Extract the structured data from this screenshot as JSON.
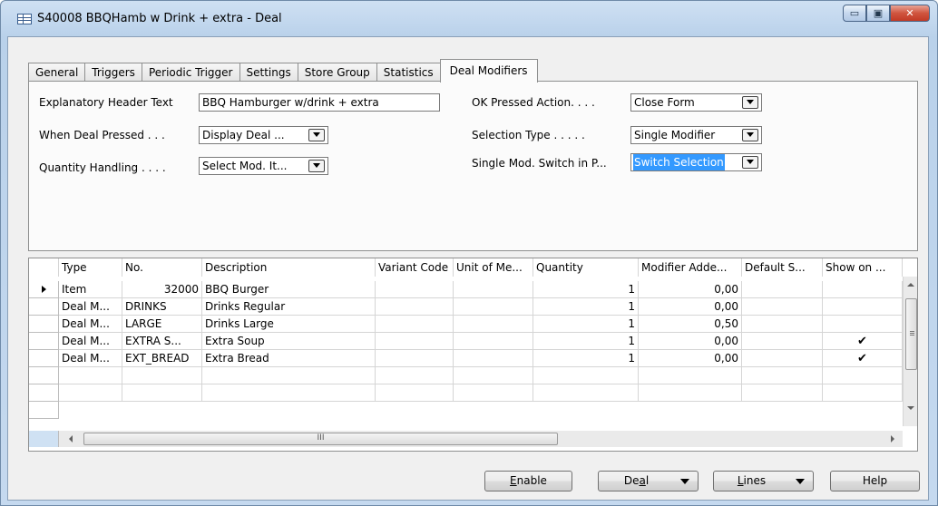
{
  "window": {
    "title": "S40008 BBQHamb w Drink + extra - Deal",
    "controls": {
      "minimize": "▭",
      "maximize": "▣",
      "close": "✕"
    }
  },
  "tabs": [
    "General",
    "Triggers",
    "Periodic Trigger",
    "Settings",
    "Store Group",
    "Statistics",
    "Deal Modifiers"
  ],
  "active_tab": "Deal Modifiers",
  "form": {
    "explanatory_header_label": "Explanatory Header Text",
    "explanatory_header_value": "BBQ Hamburger w/drink + extra",
    "when_deal_pressed_label": "When Deal Pressed . . .",
    "when_deal_pressed_value": "Display Deal ...",
    "quantity_handling_label": "Quantity Handling . . . .",
    "quantity_handling_value": "Select Mod. It...",
    "ok_pressed_action_label": "OK Pressed Action. . . .",
    "ok_pressed_action_value": "Close Form",
    "selection_type_label": "Selection Type . . . . .",
    "selection_type_value": "Single Modifier",
    "single_mod_switch_label": "Single Mod. Switch in P...",
    "single_mod_switch_value": "Switch Selection"
  },
  "grid": {
    "columns": [
      "Type",
      "No.",
      "Description",
      "Variant Code",
      "Unit of Me...",
      "Quantity",
      "Modifier Adde...",
      "Default S...",
      "Show on ..."
    ],
    "rows": [
      {
        "type": "Item",
        "no": "32000",
        "description": "BBQ Burger",
        "variant": "",
        "unit": "",
        "quantity": "1",
        "modifier_added": "0,00",
        "default": "",
        "show": ""
      },
      {
        "type": "Deal M...",
        "no": "DRINKS",
        "description": "Drinks Regular",
        "variant": "",
        "unit": "",
        "quantity": "1",
        "modifier_added": "0,00",
        "default": "",
        "show": ""
      },
      {
        "type": "Deal M...",
        "no": "LARGE",
        "description": "Drinks Large",
        "variant": "",
        "unit": "",
        "quantity": "1",
        "modifier_added": "0,50",
        "default": "",
        "show": ""
      },
      {
        "type": "Deal M...",
        "no": "EXTRA S...",
        "description": "Extra Soup",
        "variant": "",
        "unit": "",
        "quantity": "1",
        "modifier_added": "0,00",
        "default": "",
        "show": "✔"
      },
      {
        "type": "Deal M...",
        "no": "EXT_BREAD",
        "description": "Extra Bread",
        "variant": "",
        "unit": "",
        "quantity": "1",
        "modifier_added": "0,00",
        "default": "",
        "show": "✔"
      }
    ],
    "hscroll_grip": "III"
  },
  "buttons": {
    "enable_prefix": "",
    "enable_mnemonic": "E",
    "enable_rest": "nable",
    "deal_prefix": "De",
    "deal_mnemonic": "a",
    "deal_rest": "l",
    "lines_prefix": "",
    "lines_mnemonic": "L",
    "lines_rest": "ines",
    "help": "Help"
  }
}
